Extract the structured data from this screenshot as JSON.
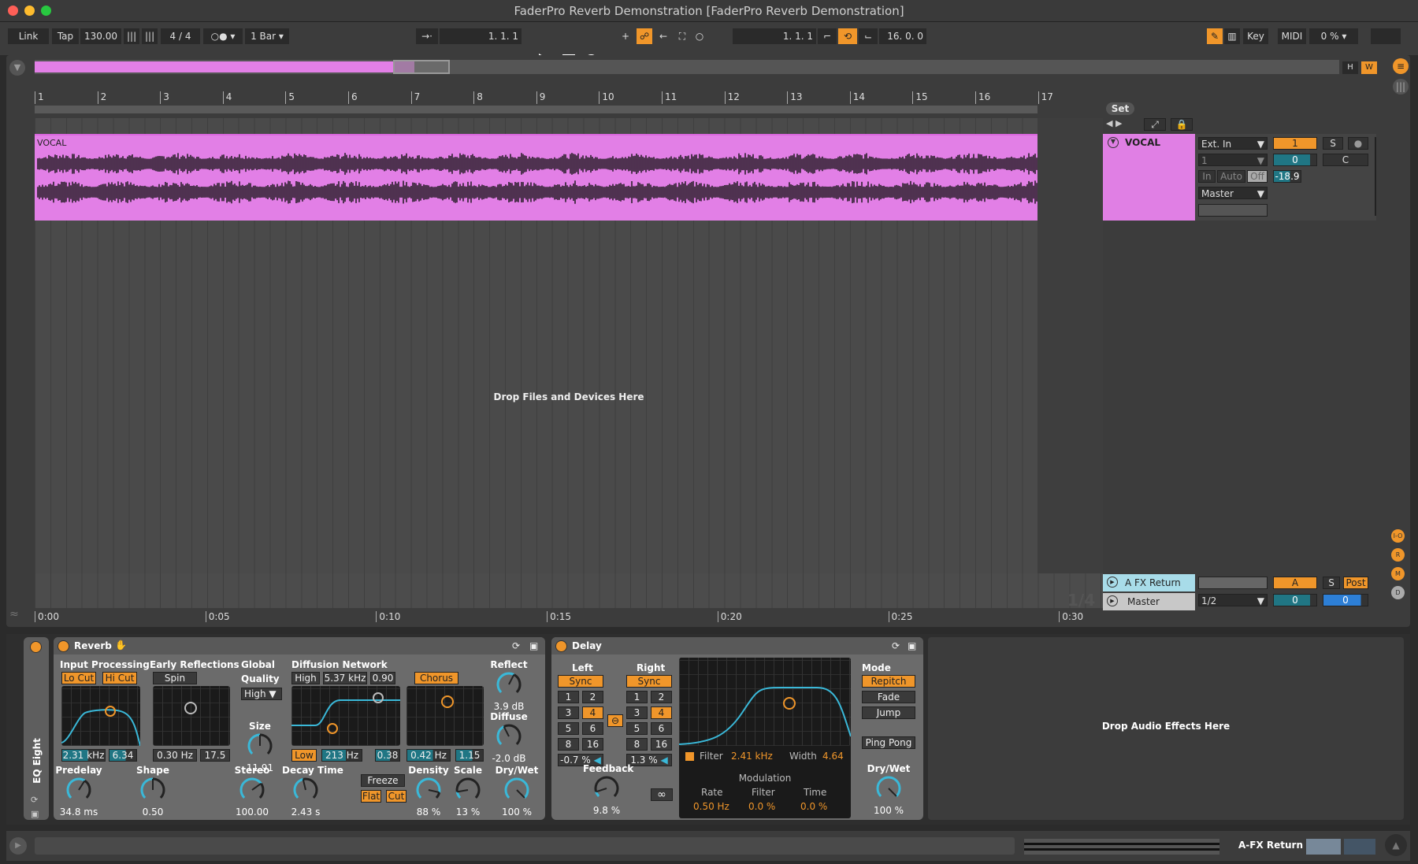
{
  "window": {
    "title": "FaderPro Reverb Demonstration  [FaderPro Reverb Demonstration]"
  },
  "toolbar": {
    "link": "Link",
    "tap": "Tap",
    "tempo": "130.00",
    "signature": "4 / 4",
    "quantize": "1 Bar",
    "position": "1.  1.  1",
    "loop_start": "1.  1.  1",
    "loop_length": "16.  0.  0",
    "key": "Key",
    "midi": "MIDI",
    "cpu": "0 %"
  },
  "ruler": {
    "bars": [
      "1",
      "2",
      "3",
      "4",
      "5",
      "6",
      "7",
      "8",
      "9",
      "10",
      "11",
      "12",
      "13",
      "14",
      "15",
      "16",
      "17"
    ]
  },
  "timeline": {
    "times": [
      "0:00",
      "0:05",
      "0:10",
      "0:15",
      "0:20",
      "0:25",
      "0:30"
    ]
  },
  "arrangement": {
    "drop_hint": "Drop Files and Devices Here",
    "set_label": "Set",
    "scale_label": "1/4"
  },
  "tracks": [
    {
      "name": "VOCAL",
      "clip_name": "VOCAL",
      "input": "Ext. In",
      "channel": "1",
      "monitor": [
        "In",
        "Auto",
        "Off"
      ],
      "output": "Master",
      "number": "1",
      "solo": "S",
      "volume": "0",
      "pan": "C",
      "meter": "-18.9",
      "color": "#e27fe6"
    }
  ],
  "returns": [
    {
      "name": "A FX Return",
      "letter": "A",
      "solo": "S",
      "post": "Post",
      "color": "#a8dce9"
    }
  ],
  "master": {
    "name": "Master",
    "cue_out": "1/2",
    "volume": "0",
    "pan": "0"
  },
  "side_buttons": [
    "I-O",
    "R",
    "M",
    "D"
  ],
  "devices": {
    "eq": {
      "name": "EQ Eight"
    },
    "reverb": {
      "name": "Reverb",
      "input_processing": {
        "title": "Input Processing",
        "lo_cut": "Lo Cut",
        "hi_cut": "Hi Cut",
        "freq": "2.31 kHz",
        "q": "6.34"
      },
      "early": {
        "title": "Early Reflections",
        "spin": "Spin",
        "rate": "0.30 Hz",
        "amount": "17.5"
      },
      "global": {
        "title": "Global",
        "quality_label": "Quality",
        "quality": "High",
        "size_label": "Size",
        "size": "11.91"
      },
      "diffusion": {
        "title": "Diffusion Network",
        "high": "High",
        "high_freq": "5.37 kHz",
        "high_val": "0.90",
        "chorus": "Chorus",
        "low": "Low",
        "low_freq": "213 Hz",
        "low_val": "0.38",
        "chorus_rate": "0.42 Hz",
        "chorus_amt": "1.15"
      },
      "reflect": {
        "label": "Reflect",
        "value": "3.9 dB"
      },
      "diffuse": {
        "label": "Diffuse",
        "value": "-2.0 dB"
      },
      "predelay": {
        "label": "Predelay",
        "value": "34.8 ms"
      },
      "shape": {
        "label": "Shape",
        "value": "0.50"
      },
      "stereo": {
        "label": "Stereo",
        "value": "100.00"
      },
      "decay": {
        "label": "Decay Time",
        "value": "2.43 s"
      },
      "freeze": "Freeze",
      "flat": "Flat",
      "cut": "Cut",
      "density": {
        "label": "Density",
        "value": "88 %"
      },
      "scale": {
        "label": "Scale",
        "value": "13 %"
      },
      "drywet": {
        "label": "Dry/Wet",
        "value": "100 %"
      }
    },
    "delay": {
      "name": "Delay",
      "left": "Left",
      "right": "Right",
      "sync": "Sync",
      "divisions": [
        "1",
        "2",
        "3",
        "4",
        "5",
        "6",
        "8",
        "16"
      ],
      "left_offset": "-0.7 %",
      "right_offset": "1.3 %",
      "feedback": {
        "label": "Feedback",
        "value": "9.8 %"
      },
      "filter_label": "Filter",
      "filter": "2.41 kHz",
      "width_label": "Width",
      "width": "4.64",
      "modulation": "Modulation",
      "rate_label": "Rate",
      "rate": "0.50 Hz",
      "mfilter_label": "Filter",
      "mfilter": "0.0 %",
      "time_label": "Time",
      "time": "0.0 %",
      "mode": "Mode",
      "modes": [
        "Repitch",
        "Fade",
        "Jump"
      ],
      "ping_pong": "Ping Pong",
      "drywet": {
        "label": "Dry/Wet",
        "value": "100 %"
      }
    },
    "drop_effects": "Drop Audio Effects Here"
  },
  "statusbar": {
    "track": "A-FX Return"
  },
  "colors": {
    "accent": "#f0962a",
    "teal": "#3ab8d8",
    "clip": "#e27fe6"
  }
}
